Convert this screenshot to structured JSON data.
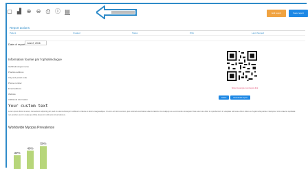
{
  "toolbar": {
    "icons": [
      "file-icon",
      "chart-icon",
      "zoom-in-icon",
      "zoom-out-icon",
      "print-icon",
      "info-icon",
      "document-icon"
    ]
  },
  "actions": {
    "orange_label": "Edit report",
    "blue_label": "Save report"
  },
  "report": {
    "section_title": "Report actions",
    "columns": [
      "Patient",
      "Created",
      "Status",
      "Who",
      "Last changed"
    ],
    "date_label": "Date of report",
    "date_value": "June 2, 2016"
  },
  "information": {
    "title": "Information fournie par l'ophtalmologue",
    "lines": [
      "Ophthalmologist name",
      "Practice address",
      "City and postal code",
      "Phone number",
      "Email address",
      "Website",
      "Additional information"
    ]
  },
  "qr": {
    "url": "https://example.com/report-link",
    "share_label": "Share",
    "download_label": "Download report"
  },
  "custom": {
    "title": "Your custom text",
    "body": "Lorem ipsum dolor sit amet, consectetur adipiscing elit, sed do eiusmod tempor incididunt ut labore et dolore magna aliqua. Ut enim ad minim veniam, quis nostrud exercitation ullamco laboris nisi ut aliquip ex ea commodo consequat. Duis aute irure dolor in reprehenderit in voluptate velit esse cillum dolore eu fugiat nulla pariatur. Excepteur sint occaecat cupidatat non proident, sunt in culpa qui officia deserunt mollit anim id est laborum."
  },
  "chart_title": "Worldwide Myopia Prevalence",
  "chart_data": {
    "type": "bar",
    "title": "Worldwide Myopia Prevalence",
    "categories": [
      "",
      "",
      ""
    ],
    "values": [
      30,
      40,
      50
    ],
    "value_labels": [
      "30%",
      "40%",
      "50%"
    ],
    "ylim": [
      0,
      60
    ],
    "color": "#b7d67a"
  },
  "colors": {
    "accent": "#2e8bc9",
    "orange": "#f0a341",
    "blue": "#1e88e5",
    "qr_url": "#e0456d"
  }
}
